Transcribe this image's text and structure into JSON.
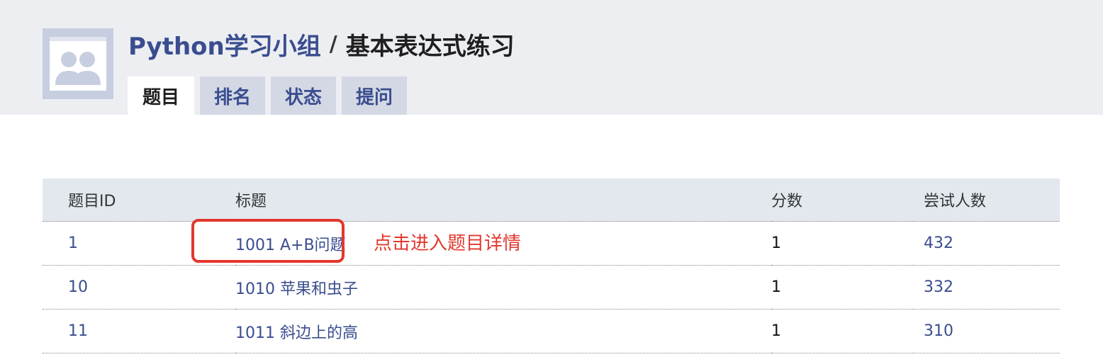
{
  "header": {
    "group_name": "Python学习小组",
    "separator": "/",
    "page_title": "基本表达式练习",
    "avatar_icon": "group-avatar-icon"
  },
  "tabs": [
    {
      "label": "题目",
      "active": true
    },
    {
      "label": "排名",
      "active": false
    },
    {
      "label": "状态",
      "active": false
    },
    {
      "label": "提问",
      "active": false
    }
  ],
  "table": {
    "columns": [
      "题目ID",
      "标题",
      "分数",
      "尝试人数"
    ],
    "rows": [
      {
        "id": "1",
        "title": "1001 A+B问题",
        "score": "1",
        "tries": "432"
      },
      {
        "id": "10",
        "title": "1010 苹果和虫子",
        "score": "1",
        "tries": "332"
      },
      {
        "id": "11",
        "title": "1011 斜边上的高",
        "score": "1",
        "tries": "310"
      }
    ]
  },
  "annotation": {
    "text": "点击进入题目详情",
    "color": "#e2382f"
  },
  "colors": {
    "link": "#3a4d8f",
    "header_bg": "#eceef2",
    "table_header_bg": "#e3e8ef",
    "tab_bg": "#d3d8e4"
  }
}
